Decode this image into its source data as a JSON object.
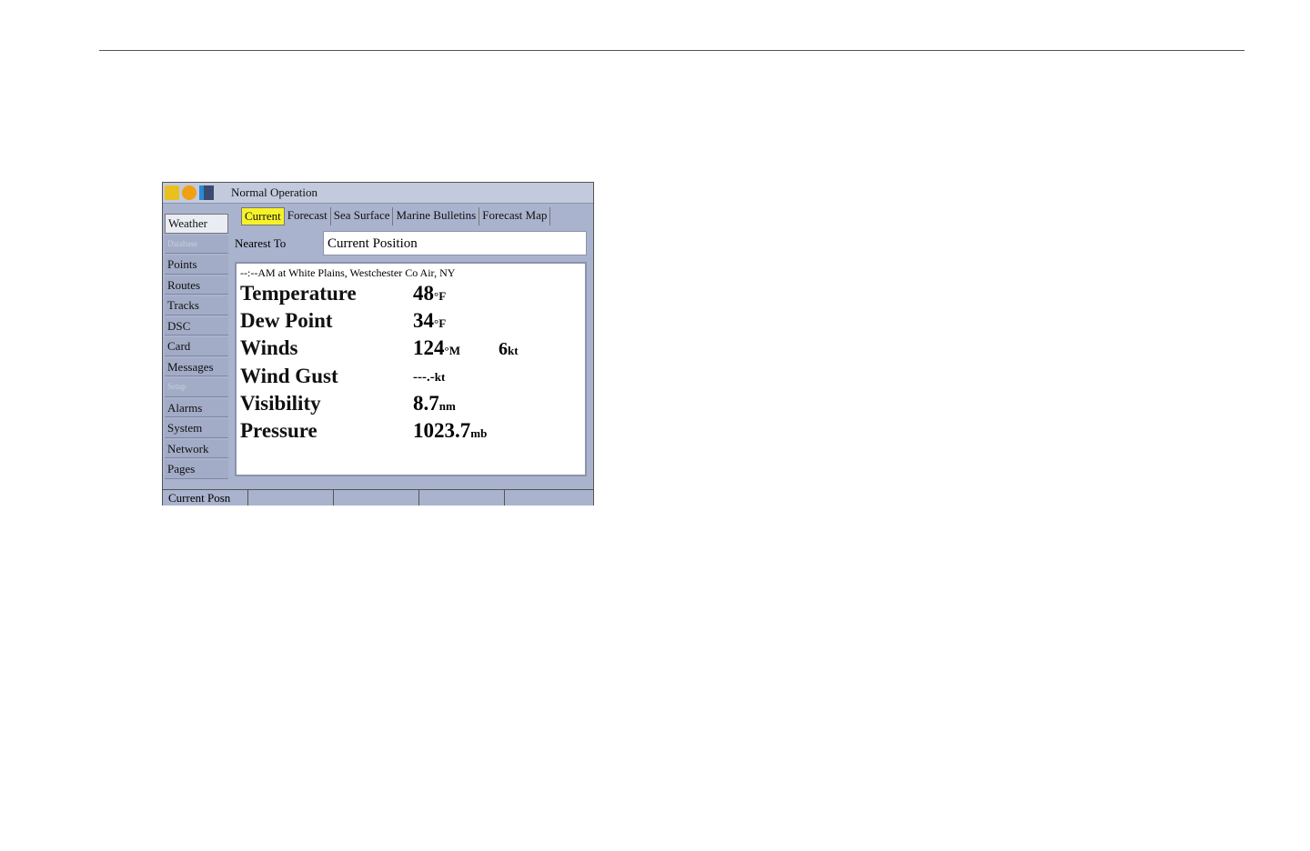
{
  "title": "Normal Operation",
  "status_icons": [
    "gps-icon",
    "sun-icon",
    "network-icon"
  ],
  "sidebar": {
    "items": [
      {
        "label": "Weather",
        "state": "selected"
      },
      {
        "label": "Database",
        "state": "disabled"
      },
      {
        "label": "Points"
      },
      {
        "label": "Routes"
      },
      {
        "label": "Tracks"
      },
      {
        "label": "DSC"
      },
      {
        "label": "Card"
      },
      {
        "label": "Messages"
      },
      {
        "label": "Setup",
        "state": "disabled"
      },
      {
        "label": "Alarms"
      },
      {
        "label": "System"
      },
      {
        "label": "Network"
      },
      {
        "label": "Pages"
      }
    ]
  },
  "tabs": [
    {
      "label": "Current",
      "selected": true
    },
    {
      "label": "Forecast"
    },
    {
      "label": "Sea Surface"
    },
    {
      "label": "Marine Bulletins"
    },
    {
      "label": "Forecast Map"
    }
  ],
  "nearest": {
    "label": "Nearest To",
    "value": "Current Position"
  },
  "report": {
    "header": "--:--AM at White Plains, Westchester Co Air, NY",
    "rows": [
      {
        "label": "Temperature",
        "value": "48",
        "unit": "°F"
      },
      {
        "label": "Dew Point",
        "value": "34",
        "unit": "°F"
      },
      {
        "label": "Winds",
        "value": "124",
        "unit": "°M",
        "extra": "6",
        "extra_unit": "kt"
      },
      {
        "label": "Wind Gust",
        "value": "---.-",
        "unit": "kt"
      },
      {
        "label": "Visibility",
        "value": "8.7",
        "unit": "nm"
      },
      {
        "label": "Pressure",
        "value": "1023.7",
        "unit": "mb"
      }
    ]
  },
  "softkeys": [
    "Current Posn",
    "",
    "",
    "",
    ""
  ],
  "colors": {
    "tab_highlight": "#f6f22a",
    "panel": "#aab3cd"
  }
}
